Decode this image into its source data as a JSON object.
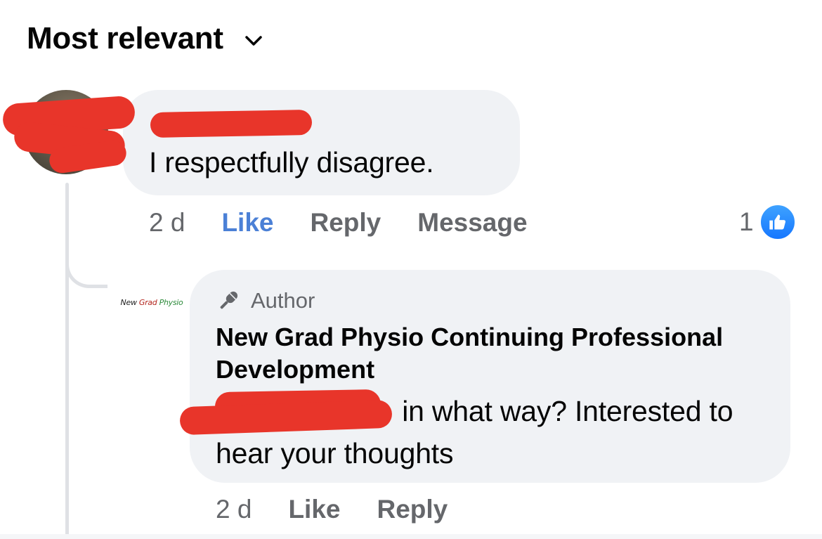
{
  "sort": {
    "label": "Most relevant",
    "icon": "chevron-down-icon"
  },
  "comment": {
    "author_redacted": true,
    "text": "I respectfully disagree.",
    "timestamp": "2 d",
    "like_label": "Like",
    "reply_label": "Reply",
    "message_label": "Message",
    "reaction_count": "1",
    "reaction_icon": "like-thumb-icon",
    "like_active_color": "#4b80d6"
  },
  "reply": {
    "avatar_logo_parts": [
      "New ",
      "Grad",
      " Physio"
    ],
    "badge_icon": "microphone-icon",
    "badge_label": "Author",
    "page_name": "New Grad Physio Continuing Professional Development",
    "text_after_mention": " in what way? Interested to hear your thoughts",
    "timestamp": "2 d",
    "like_label": "Like",
    "reply_label": "Reply"
  },
  "colors": {
    "bubble_bg": "#f0f2f5",
    "redaction": "#e8352a",
    "secondary_text": "#65676b",
    "reaction_blue": "#1677ff"
  }
}
